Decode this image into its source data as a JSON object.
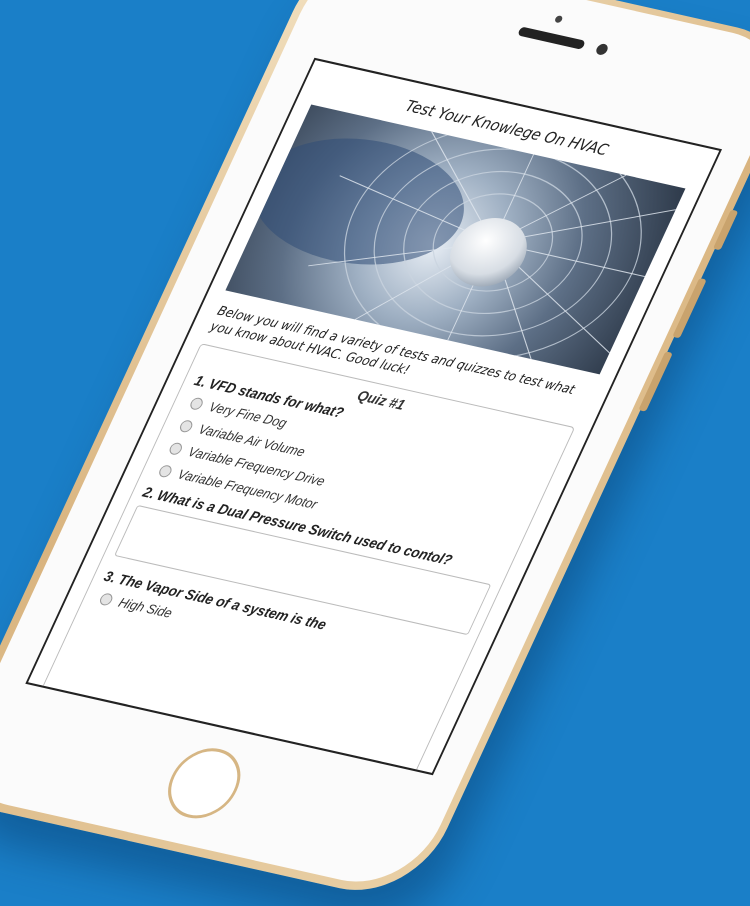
{
  "screen": {
    "title": "Test Your Knowlege On HVAC",
    "hero_image": "industrial-fan-image",
    "intro": "Below you will find a variety of tests and quizzes to test what you know about HVAC. Good luck!"
  },
  "quiz": {
    "title": "Quiz #1",
    "q1": {
      "text": "1. VFD stands for what?",
      "options": [
        "Very Fine Dog",
        "Variable Air Volume",
        "Variable Frequency Drive",
        "Variable Frequency Motor"
      ]
    },
    "q2": {
      "text": "2. What is a Dual Pressure Switch used to contol?"
    },
    "q3": {
      "text": "3. The Vapor Side of a system is the",
      "options": [
        "High Side"
      ]
    }
  },
  "colors": {
    "background": "#1a7fc8",
    "phone_frame": "#d9b47f"
  }
}
